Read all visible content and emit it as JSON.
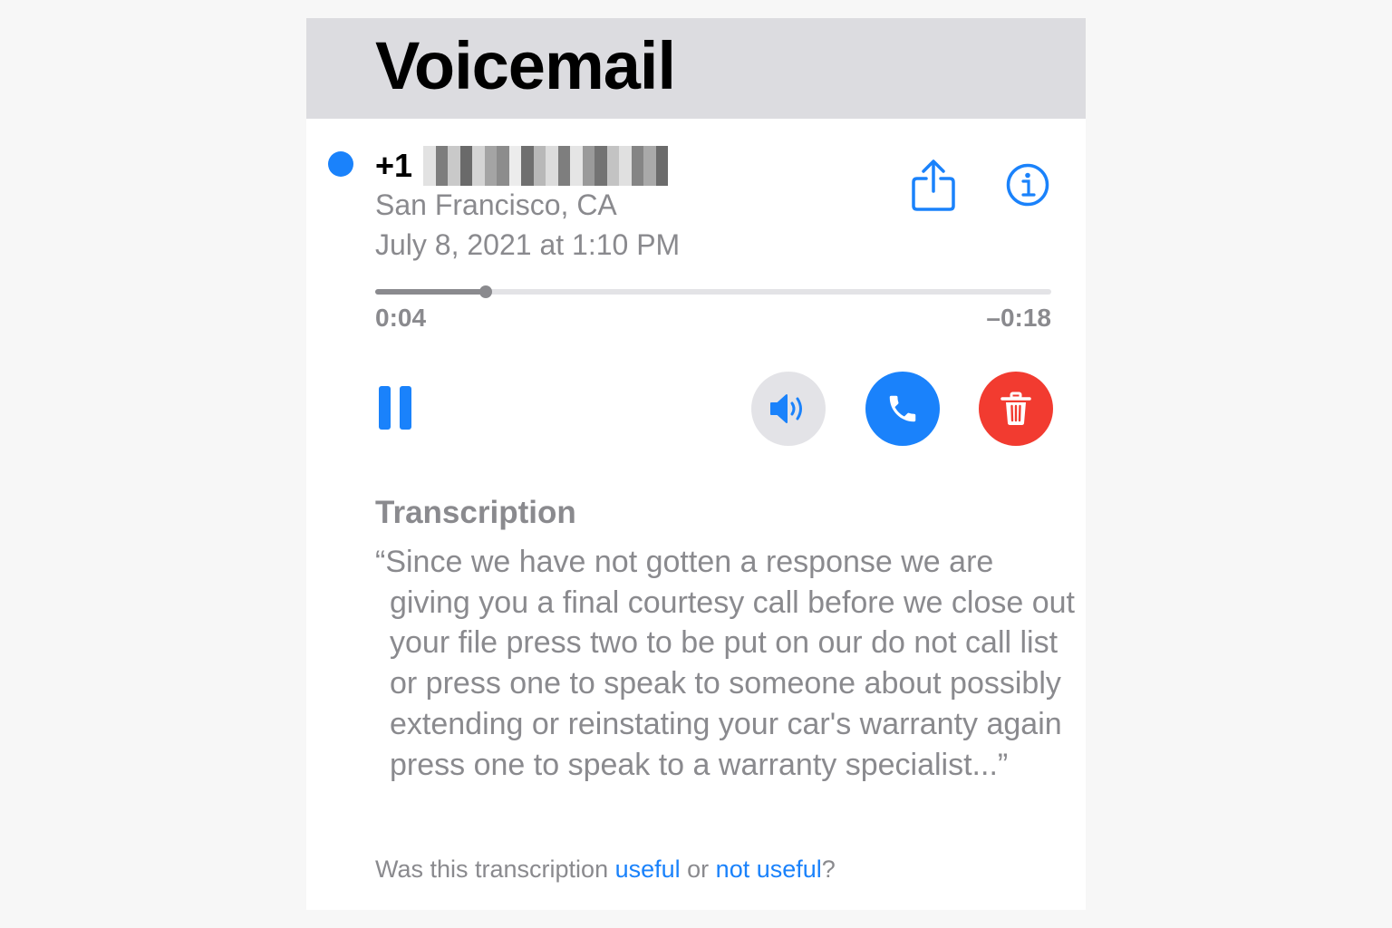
{
  "header": {
    "title": "Voicemail"
  },
  "voicemail": {
    "unread": true,
    "caller_prefix": "+1",
    "caller_number_redacted": true,
    "location": "San Francisco, CA",
    "datetime": "July 8, 2021 at 1:10 PM",
    "share_icon": "share-icon",
    "info_icon": "info-icon"
  },
  "playback": {
    "elapsed": "0:04",
    "remaining": "–0:18",
    "progress": 0.164,
    "state": "playing",
    "pause_icon": "pause-icon",
    "speaker_icon": "speaker-icon",
    "call_icon": "phone-icon",
    "delete_icon": "trash-icon"
  },
  "transcription": {
    "title": "Transcription",
    "text": "“Since we have not gotten a response we are giving you a final courtesy call before we close out your file press two to be put on our do not call list or press one to speak to someone about possibly extending or reinstating your car's warranty again press one to speak to a warranty specialist...”",
    "feedback_prefix": "Was this transcription ",
    "feedback_useful": "useful",
    "feedback_or": " or ",
    "feedback_not_useful": "not useful",
    "feedback_suffix": "?"
  },
  "colors": {
    "accent": "#1a82fb",
    "destructive": "#f23b30",
    "secondary_text": "#8a8a8e",
    "header_bg": "#dcdce0"
  }
}
